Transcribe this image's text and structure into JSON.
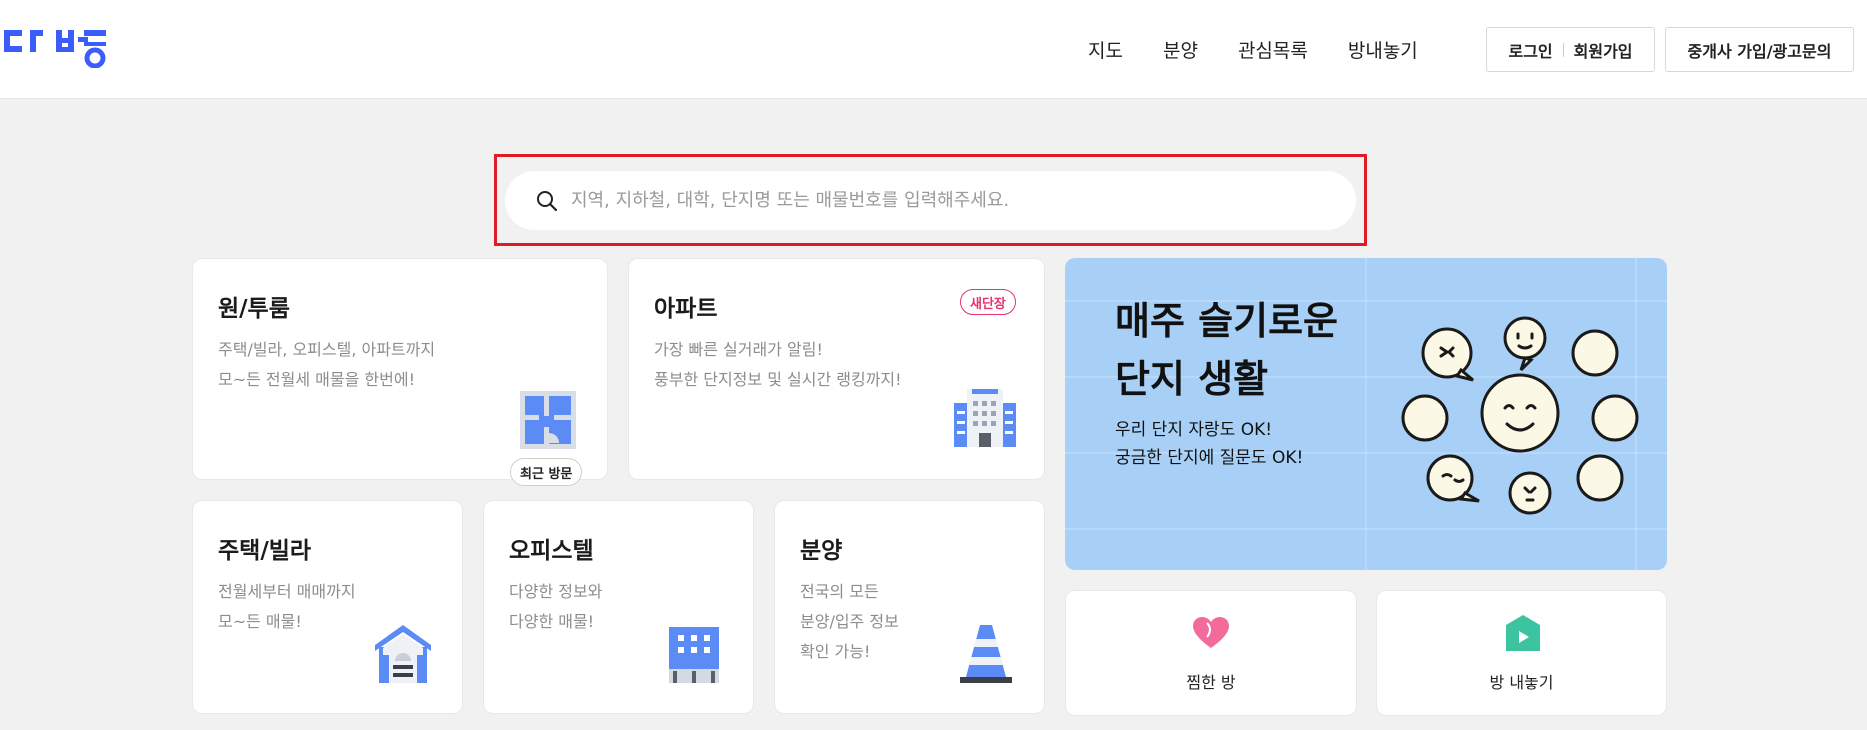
{
  "brand": {
    "name": "다방",
    "accent": "#3b5dfb"
  },
  "nav": {
    "items": [
      "지도",
      "분양",
      "관심목록",
      "방내놓기"
    ]
  },
  "auth": {
    "login": "로그인",
    "signup": "회원가입"
  },
  "agent_button": "중개사 가입/광고문의",
  "search": {
    "placeholder": "지역, 지하철, 대학, 단지명 또는 매물번호를 입력해주세요.",
    "value": ""
  },
  "cards": {
    "oneroom": {
      "title": "원/투룸",
      "desc1": "주택/빌라, 오피스텔, 아파트까지",
      "desc2": "모~든 전월세 매물을 한번에!",
      "badge": "최근 방문"
    },
    "apartment": {
      "title": "아파트",
      "desc1": "가장 빠른 실거래가 알림!",
      "desc2": "풍부한 단지정보 및 실시간 랭킹까지!",
      "badge": "새단장"
    },
    "villa": {
      "title": "주택/빌라",
      "desc1": "전월세부터 매매까지",
      "desc2": "모~든 매물!"
    },
    "officetel": {
      "title": "오피스텔",
      "desc1": "다양한 정보와",
      "desc2": "다양한 매물!"
    },
    "presale": {
      "title": "분양",
      "desc1": "전국의 모든",
      "desc2": "분양/입주 정보",
      "desc3": "확인 가능!"
    }
  },
  "promo": {
    "title1": "매주 슬기로운",
    "title2": "단지 생활",
    "desc1": "우리 단지 자랑도 OK!",
    "desc2": "궁금한 단지에 질문도 OK!"
  },
  "quick": {
    "liked": "찜한 방",
    "list_room": "방 내놓기"
  },
  "colors": {
    "highlight": "#e01b24",
    "badge_pink": "#e8336b",
    "promo_bg": "#a8d0f7",
    "icon_blue": "#5b8cf5",
    "heart_pink": "#f26b9a",
    "house_green": "#3cc4a0"
  }
}
